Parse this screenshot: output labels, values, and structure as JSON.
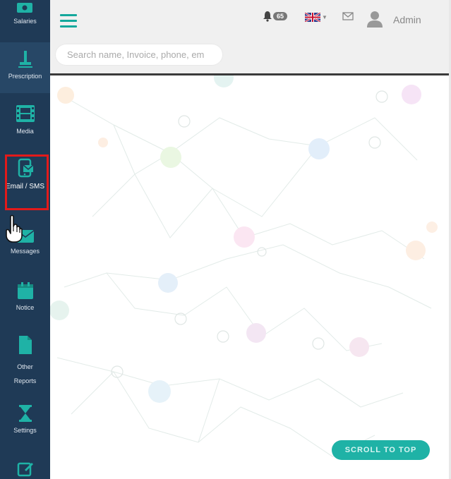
{
  "sidebar": {
    "items": [
      {
        "label": "Salaries",
        "icon": "salaries-icon"
      },
      {
        "label": "Prescription",
        "icon": "prescription-icon"
      },
      {
        "label": "Media",
        "icon": "media-icon"
      },
      {
        "label": "Email / SMS",
        "icon": "email-sms-icon"
      },
      {
        "label": "Messages",
        "icon": "messages-icon"
      },
      {
        "label": "Notice",
        "icon": "notice-icon"
      },
      {
        "label": "Other Reports",
        "icon": "other-reports-icon"
      },
      {
        "label": "Settings",
        "icon": "settings-icon"
      },
      {
        "label": "",
        "icon": "edit-icon"
      }
    ]
  },
  "header": {
    "notification_count": "65",
    "search_placeholder": "Search name, Invoice, phone, em",
    "admin_name": "Admin"
  },
  "content": {
    "scroll_to_top_label": "SCROLL TO TOP"
  },
  "colors": {
    "sidebar": "#1f3a56",
    "accent": "#1fb2a6",
    "highlight": "#e21a1a"
  }
}
